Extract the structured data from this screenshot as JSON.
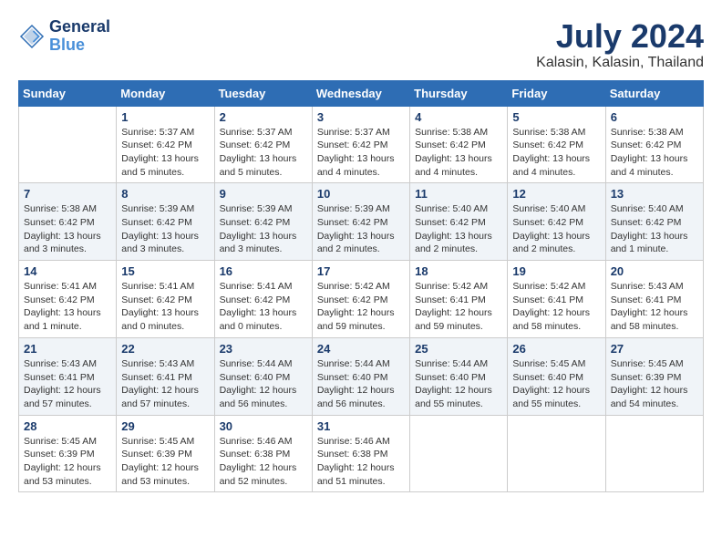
{
  "header": {
    "logo_line1": "General",
    "logo_line2": "Blue",
    "month_year": "July 2024",
    "location": "Kalasin, Kalasin, Thailand"
  },
  "days_of_week": [
    "Sunday",
    "Monday",
    "Tuesday",
    "Wednesday",
    "Thursday",
    "Friday",
    "Saturday"
  ],
  "weeks": [
    [
      {
        "day": "",
        "info": ""
      },
      {
        "day": "1",
        "info": "Sunrise: 5:37 AM\nSunset: 6:42 PM\nDaylight: 13 hours\nand 5 minutes."
      },
      {
        "day": "2",
        "info": "Sunrise: 5:37 AM\nSunset: 6:42 PM\nDaylight: 13 hours\nand 5 minutes."
      },
      {
        "day": "3",
        "info": "Sunrise: 5:37 AM\nSunset: 6:42 PM\nDaylight: 13 hours\nand 4 minutes."
      },
      {
        "day": "4",
        "info": "Sunrise: 5:38 AM\nSunset: 6:42 PM\nDaylight: 13 hours\nand 4 minutes."
      },
      {
        "day": "5",
        "info": "Sunrise: 5:38 AM\nSunset: 6:42 PM\nDaylight: 13 hours\nand 4 minutes."
      },
      {
        "day": "6",
        "info": "Sunrise: 5:38 AM\nSunset: 6:42 PM\nDaylight: 13 hours\nand 4 minutes."
      }
    ],
    [
      {
        "day": "7",
        "info": "Sunrise: 5:38 AM\nSunset: 6:42 PM\nDaylight: 13 hours\nand 3 minutes."
      },
      {
        "day": "8",
        "info": "Sunrise: 5:39 AM\nSunset: 6:42 PM\nDaylight: 13 hours\nand 3 minutes."
      },
      {
        "day": "9",
        "info": "Sunrise: 5:39 AM\nSunset: 6:42 PM\nDaylight: 13 hours\nand 3 minutes."
      },
      {
        "day": "10",
        "info": "Sunrise: 5:39 AM\nSunset: 6:42 PM\nDaylight: 13 hours\nand 2 minutes."
      },
      {
        "day": "11",
        "info": "Sunrise: 5:40 AM\nSunset: 6:42 PM\nDaylight: 13 hours\nand 2 minutes."
      },
      {
        "day": "12",
        "info": "Sunrise: 5:40 AM\nSunset: 6:42 PM\nDaylight: 13 hours\nand 2 minutes."
      },
      {
        "day": "13",
        "info": "Sunrise: 5:40 AM\nSunset: 6:42 PM\nDaylight: 13 hours\nand 1 minute."
      }
    ],
    [
      {
        "day": "14",
        "info": "Sunrise: 5:41 AM\nSunset: 6:42 PM\nDaylight: 13 hours\nand 1 minute."
      },
      {
        "day": "15",
        "info": "Sunrise: 5:41 AM\nSunset: 6:42 PM\nDaylight: 13 hours\nand 0 minutes."
      },
      {
        "day": "16",
        "info": "Sunrise: 5:41 AM\nSunset: 6:42 PM\nDaylight: 13 hours\nand 0 minutes."
      },
      {
        "day": "17",
        "info": "Sunrise: 5:42 AM\nSunset: 6:42 PM\nDaylight: 12 hours\nand 59 minutes."
      },
      {
        "day": "18",
        "info": "Sunrise: 5:42 AM\nSunset: 6:41 PM\nDaylight: 12 hours\nand 59 minutes."
      },
      {
        "day": "19",
        "info": "Sunrise: 5:42 AM\nSunset: 6:41 PM\nDaylight: 12 hours\nand 58 minutes."
      },
      {
        "day": "20",
        "info": "Sunrise: 5:43 AM\nSunset: 6:41 PM\nDaylight: 12 hours\nand 58 minutes."
      }
    ],
    [
      {
        "day": "21",
        "info": "Sunrise: 5:43 AM\nSunset: 6:41 PM\nDaylight: 12 hours\nand 57 minutes."
      },
      {
        "day": "22",
        "info": "Sunrise: 5:43 AM\nSunset: 6:41 PM\nDaylight: 12 hours\nand 57 minutes."
      },
      {
        "day": "23",
        "info": "Sunrise: 5:44 AM\nSunset: 6:40 PM\nDaylight: 12 hours\nand 56 minutes."
      },
      {
        "day": "24",
        "info": "Sunrise: 5:44 AM\nSunset: 6:40 PM\nDaylight: 12 hours\nand 56 minutes."
      },
      {
        "day": "25",
        "info": "Sunrise: 5:44 AM\nSunset: 6:40 PM\nDaylight: 12 hours\nand 55 minutes."
      },
      {
        "day": "26",
        "info": "Sunrise: 5:45 AM\nSunset: 6:40 PM\nDaylight: 12 hours\nand 55 minutes."
      },
      {
        "day": "27",
        "info": "Sunrise: 5:45 AM\nSunset: 6:39 PM\nDaylight: 12 hours\nand 54 minutes."
      }
    ],
    [
      {
        "day": "28",
        "info": "Sunrise: 5:45 AM\nSunset: 6:39 PM\nDaylight: 12 hours\nand 53 minutes."
      },
      {
        "day": "29",
        "info": "Sunrise: 5:45 AM\nSunset: 6:39 PM\nDaylight: 12 hours\nand 53 minutes."
      },
      {
        "day": "30",
        "info": "Sunrise: 5:46 AM\nSunset: 6:38 PM\nDaylight: 12 hours\nand 52 minutes."
      },
      {
        "day": "31",
        "info": "Sunrise: 5:46 AM\nSunset: 6:38 PM\nDaylight: 12 hours\nand 51 minutes."
      },
      {
        "day": "",
        "info": ""
      },
      {
        "day": "",
        "info": ""
      },
      {
        "day": "",
        "info": ""
      }
    ]
  ]
}
